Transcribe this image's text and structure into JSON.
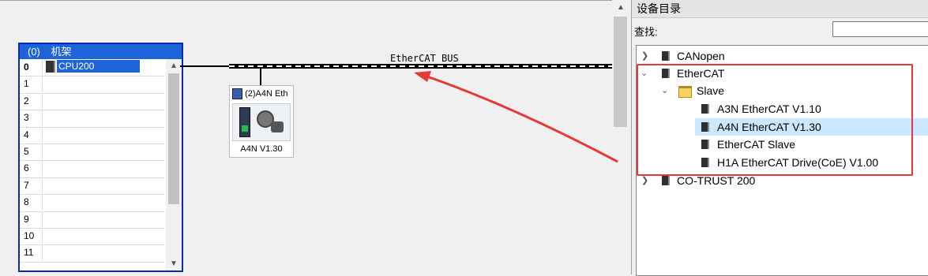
{
  "rack": {
    "title_num": "(0)",
    "title": "机架",
    "rows": [
      "0",
      "1",
      "2",
      "3",
      "4",
      "5",
      "6",
      "7",
      "8",
      "9",
      "10",
      "11"
    ],
    "cpu_label": "CPU200"
  },
  "bus": {
    "label": "EtherCAT BUS"
  },
  "device": {
    "header": "(2)A4N Eth",
    "caption": "A4N V1.30"
  },
  "catalog": {
    "title": "设备目录",
    "search_label": "查找:",
    "search_value": "",
    "items": {
      "canopen": "CANopen",
      "ethercat": "EtherCAT",
      "slave": "Slave",
      "a3n": "A3N EtherCAT V1.10",
      "a4n": "A4N EtherCAT V1.30",
      "ethercat_slave": "EtherCAT Slave",
      "h1a": "H1A EtherCAT Drive(CoE) V1.00",
      "cotrust": "CO-TRUST 200"
    }
  },
  "colors": {
    "annotation": "#e53935",
    "selection": "#cce8ff",
    "rack_header": "#1e63d8"
  }
}
